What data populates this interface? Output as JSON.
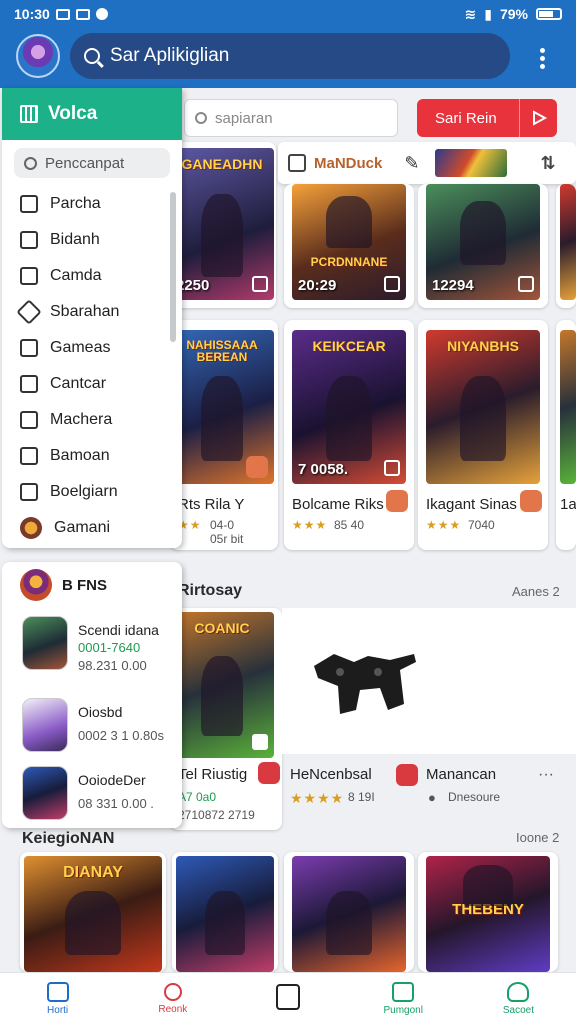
{
  "status_bar": {
    "time": "10:30",
    "battery": "79%"
  },
  "app_bar": {
    "search_text": "Sar Aplikiglian"
  },
  "filter": {
    "placeholder": "sapiaran",
    "red_button_label": "Sari Rein"
  },
  "toolstrip": {
    "title": "MaNDuck"
  },
  "drawer": {
    "title": "Volca",
    "search_placeholder": "Penccanpat",
    "items": [
      "Parcha",
      "Bidanh",
      "Camda",
      "Sbarahan",
      "Gameas",
      "Cantcar",
      "Machera",
      "Bamoan",
      "Boelgiarn",
      "Gamani"
    ]
  },
  "fans": {
    "title": "B FNS",
    "apps": [
      {
        "name": "Scendi idana",
        "sub": "0001-7640",
        "sub2": "98.231 0.00"
      },
      {
        "name": "Oiosbd",
        "sub": "0002 3 1 0.80s"
      },
      {
        "name": "OoiodeDer",
        "sub": "08 331 0.00 ."
      }
    ]
  },
  "row1": [
    {
      "banner": "GANEADHN",
      "count": "2250"
    },
    {
      "banner": "PCRDNNANE",
      "count": "20:29"
    },
    {
      "banner": "",
      "count": "12294"
    }
  ],
  "row2": [
    {
      "banner": "NAHISSAAA BEREAN",
      "title": "Rts Rila Y",
      "rating": "04-0",
      "meta": "05r bit"
    },
    {
      "banner": "KEIKCEAR",
      "count": "7 0058.",
      "title": "Bolcame Riks",
      "rating": "85 40"
    },
    {
      "banner": "NIYANBHS",
      "title": "Ikagant Sinas",
      "rating": "7040"
    },
    {
      "title": "1a",
      "rating": ""
    }
  ],
  "section_recent": {
    "title": "Rirtosay",
    "more": "Aanes 2"
  },
  "row3": [
    {
      "banner": "COANIC",
      "title": "Tel Riustig",
      "rating": "A7 0a0",
      "meta": "2710872 2719"
    },
    {
      "title": "HeNcenbsal",
      "rating": "8 19I"
    },
    {
      "title": "Manancan",
      "meta": "Dnesoure"
    }
  ],
  "section_more": {
    "title": "KeiegioNAN",
    "more": "Ioone 2"
  },
  "row4": [
    {
      "banner": "DIANAY"
    },
    {
      "banner": ""
    },
    {
      "banner": ""
    },
    {
      "banner": "THEBENY"
    }
  ],
  "bottom_nav": [
    "Horti",
    "Reonk",
    "",
    "Pumgonl",
    "Sacoet"
  ],
  "colors": {
    "primary": "#1f6fc2",
    "accent": "#1db18a",
    "danger": "#e8323c",
    "star": "#d99e1f"
  }
}
